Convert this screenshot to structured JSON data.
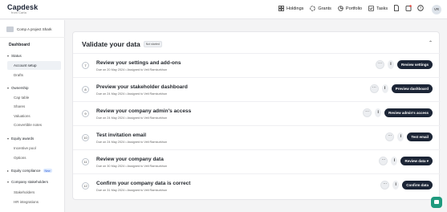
{
  "brand": {
    "name": "Capdesk",
    "sub": "from Carta"
  },
  "topnav": [
    {
      "label": "Holdings",
      "icon": "holdings-icon"
    },
    {
      "label": "Grants",
      "icon": "grants-icon"
    },
    {
      "label": "Portfolio",
      "icon": "portfolio-icon"
    },
    {
      "label": "Tasks",
      "icon": "tasks-icon"
    }
  ],
  "user_initials": "VR",
  "sidebar": {
    "company": "Comp A project Shark",
    "section": "Dashboard",
    "groups": {
      "status": "Status",
      "ownership": "Ownership",
      "equity_awards": "Equity awards",
      "equity_compliance": "Equity compliance",
      "company_stakeholders": "Company stakeholders"
    },
    "new_badge": "New",
    "items": {
      "account_setup": "Account setup",
      "drafts": "Drafts",
      "cap_table": "Cap table",
      "shares": "Shares",
      "valuations": "Valuations",
      "convertible_notes": "Convertible notes",
      "incentive_pool": "Incentive pool",
      "options": "Options",
      "stakeholders": "Stakeholders",
      "hr_integrations": "HR integrations"
    }
  },
  "card": {
    "title": "Validate your data",
    "status": "Not started",
    "more_label": "···",
    "info_label": "i",
    "steps": [
      {
        "num": "7",
        "title": "Review your settings and add-ons",
        "meta": "Due on 20 May 2024 • Assigned to Veli Ramkurkhun",
        "button": "Review settings"
      },
      {
        "num": "8",
        "title": "Preview your stakeholder dashboard",
        "meta": "Due on 24 May 2024 • Assigned to Veli Ramkurkhun",
        "button": "Preview dashboard"
      },
      {
        "num": "9",
        "title": "Review your company admin's access",
        "meta": "Due on 24 May 2024 • Assigned to Veli Ramkurkhun",
        "button": "Review admin's access"
      },
      {
        "num": "10",
        "title": "Test invitation email",
        "meta": "Due on 24 May 2024 • Assigned to Veli Ramkurkhun",
        "button": "Test email"
      },
      {
        "num": "11",
        "title": "Review your company data",
        "meta": "Due on 30 May 2024 • Assigned to Veli Ramkurkhun",
        "button": "Review data ▾"
      },
      {
        "num": "12",
        "title": "Confirm your company data is correct",
        "meta": "Due on 31 May 2024 • Assigned to Veli Ramkurkhun",
        "button": "Confirm data"
      }
    ]
  },
  "colors": {
    "primary_button": "#1c2536",
    "chat_button": "#1f9a7e"
  }
}
